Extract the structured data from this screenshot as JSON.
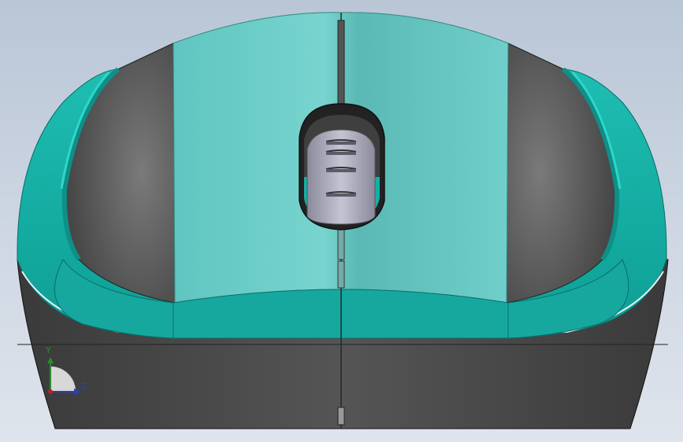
{
  "viewport": {
    "background_top": "#b9c6d6",
    "background_bottom": "#dfe4ec"
  },
  "model": {
    "name": "mouse-back-view",
    "colors": {
      "teal_shell": "#19b7ac",
      "teal_light": "#6fd0cb",
      "dark_body": "#4a4a4a",
      "dark_panel": "#5a5a5a",
      "scroll_wheel": "#a8a8b8"
    }
  },
  "triad": {
    "y_label": "Y",
    "z_label": "Z",
    "y_color": "#2a8a2a",
    "z_color": "#2a3fc0",
    "x_color": "#c02020"
  }
}
